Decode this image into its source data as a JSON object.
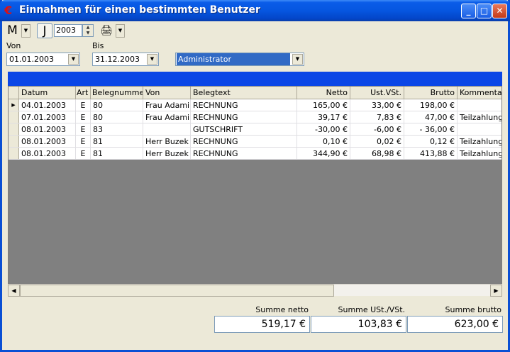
{
  "window": {
    "title": "Einnahmen für einen bestimmten Benutzer"
  },
  "toolbar": {
    "m_label": "M",
    "j_label": "J",
    "year_value": "2003"
  },
  "filter": {
    "from_label": "Von",
    "from_value": "01.01.2003",
    "to_label": "Bis",
    "to_value": "31.12.2003",
    "user_value": "Administrator"
  },
  "table": {
    "columns": [
      "Datum",
      "Art",
      "Belegnummer",
      "Von",
      "Belegtext",
      "Netto",
      "Ust.VSt.",
      "Brutto",
      "Kommentar"
    ],
    "rows": [
      [
        "04.01.2003",
        "E",
        "80",
        "Frau Adami",
        "RECHNUNG",
        "165,00 €",
        "33,00 €",
        "198,00 €",
        ""
      ],
      [
        "07.01.2003",
        "E",
        "80",
        "Frau Adami",
        "RECHNUNG",
        "39,17 €",
        "7,83 €",
        "47,00 €",
        "Teilzahlung:"
      ],
      [
        "08.01.2003",
        "E",
        "83",
        "",
        "GUTSCHRIFT",
        "-30,00 €",
        "-6,00 €",
        "- 36,00 €",
        ""
      ],
      [
        "08.01.2003",
        "E",
        "81",
        "Herr Buzek",
        "RECHNUNG",
        "0,10 €",
        "0,02 €",
        "0,12 €",
        "Teilzahlung:"
      ],
      [
        "08.01.2003",
        "E",
        "81",
        "Herr Buzek",
        "RECHNUNG",
        "344,90 €",
        "68,98 €",
        "413,88 €",
        "Teilzahlung:"
      ]
    ]
  },
  "summary": {
    "netto_label": "Summe netto",
    "netto_value": "519,17 €",
    "ust_label": "Summe USt./VSt.",
    "ust_value": "103,83 €",
    "brutto_label": "Summe brutto",
    "brutto_value": "623,00 €"
  },
  "colors": {
    "titlebar": "#0656e0",
    "selection": "#316ac5",
    "grid_empty": "#808080"
  }
}
